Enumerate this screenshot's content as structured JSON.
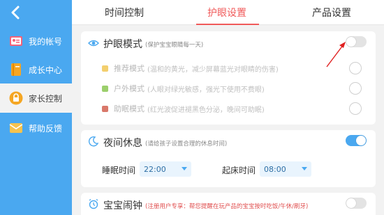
{
  "sidebar": {
    "items": [
      {
        "label": "我的帐号",
        "icon": "id-card-icon"
      },
      {
        "label": "成长中心",
        "icon": "book-icon"
      },
      {
        "label": "家长控制",
        "icon": "lock-icon",
        "active": true
      },
      {
        "label": "帮助反馈",
        "icon": "envelope-icon"
      }
    ]
  },
  "tabs": [
    {
      "label": "时间控制"
    },
    {
      "label": "护眼设置",
      "active": true
    },
    {
      "label": "产品设置"
    }
  ],
  "eye_protection": {
    "title": "护眼模式",
    "note": "(保护宝宝眼睛每一天)",
    "enabled": false,
    "options": [
      {
        "label": "推荐模式",
        "desc": "(温和的黄光，减少屏幕蓝光对眼睛的伤害)",
        "color": "#f3cf6e"
      },
      {
        "label": "户外模式",
        "desc": "(人眼对绿光敏感，强光下使用不费眼)",
        "color": "#9ccf6c"
      },
      {
        "label": "助眠模式",
        "desc": "(红光波促进褪黑色分泌，晚间可助眠)",
        "color": "#d9786a"
      }
    ]
  },
  "night_rest": {
    "title": "夜间休息",
    "note": "(请给孩子设置合理的休息时间)",
    "enabled": true,
    "sleep_label": "睡眠时间",
    "sleep_value": "22:00",
    "wake_label": "起床时间",
    "wake_value": "08:00"
  },
  "alarm": {
    "title": "宝宝闹钟",
    "note": "(注册用户专享：帮您提醒在玩产品的宝宝按时吃饭/午休/刷牙)",
    "enabled": false
  },
  "colors": {
    "accent": "#4aa8f0",
    "tab_active": "#f05a5a",
    "annotation_arrow": "#e02020"
  }
}
